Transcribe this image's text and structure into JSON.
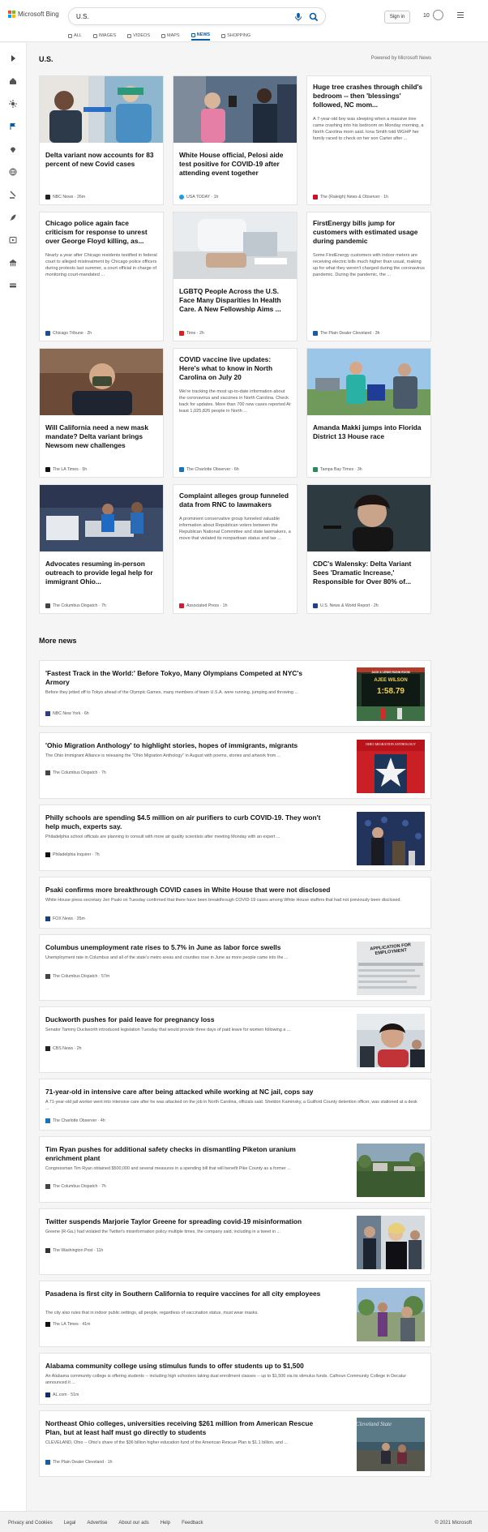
{
  "header": {
    "brand": "Microsoft Bing",
    "query": "U.S.",
    "signin": "Sign in",
    "rewards": "10"
  },
  "nav": [
    "ALL",
    "IMAGES",
    "VIDEOS",
    "MAPS",
    "NEWS",
    "SHOPPING"
  ],
  "section": {
    "title": "U.S.",
    "powered": "Powered by Microsoft News"
  },
  "cards": [
    {
      "title": "Delta variant now accounts for 83 percent of new Covid cases",
      "desc": "",
      "source": "NBC News · 26m",
      "fav": "#222"
    },
    {
      "title": "White House official, Pelosi aide test positive for COVID-19 after attending event together",
      "desc": "",
      "source": "USA TODAY · 1h",
      "fav": "#1e9be9"
    },
    {
      "title": "Huge tree crashes through child's bedroom -- then 'blessings' followed, NC mom...",
      "desc": "A 7-year-old boy was sleeping when a massive tree came crashing into his bedroom on Monday morning, a North Carolina mom said. Iona Smith told WGHP her family raced to check on her son Carter after ...",
      "source": "The (Raleigh) News & Observer · 1h",
      "fav": "#c8102e"
    },
    {
      "title": "Chicago police again face criticism for response to unrest over George Floyd killing, as...",
      "desc": "Nearly a year after Chicago residents testified in federal court to alleged mistreatment by Chicago police officers during protests last summer, a court official in charge of monitoring court-mandated ...",
      "source": "Chicago Tribune · 2h",
      "fav": "#1f4e8c"
    },
    {
      "title": "LGBTQ People Across the U.S. Face Many Disparities In Health Care. A New Fellowship Aims ...",
      "desc": "",
      "source": "Time · 2h",
      "fav": "#e01e1e"
    },
    {
      "title": "FirstEnergy bills jump for customers with estimated usage during pandemic",
      "desc": "Some FirstEnergy customers with indoor meters are receiving electric bills much higher than usual, making up for what they weren't charged during the coronavirus pandemic. During the pandemic, the ...",
      "source": "The Plain Dealer Cleveland · 3h",
      "fav": "#1a5aa8"
    },
    {
      "title": "Will California need a new mask mandate? Delta variant brings Newsom new challenges",
      "desc": "",
      "source": "The LA Times · 5h",
      "fav": "#111"
    },
    {
      "title": "COVID vaccine live updates: Here's what to know in North Carolina on July 20",
      "desc": "We're tracking the most up-to-date information about the coronavirus and vaccines in North Carolina. Check back for updates. More than 700 new cases reported At least 1,025,826 people in North ...",
      "source": "The Charlotte Observer · 6h",
      "fav": "#1772c2"
    },
    {
      "title": "Amanda Makki jumps into Florida District 13 House race",
      "desc": "",
      "source": "Tampa Bay Times · 3h",
      "fav": "#2a8a5e"
    },
    {
      "title": "Advocates resuming in-person outreach to provide legal help for immigrant Ohio...",
      "desc": "",
      "source": "The Columbus Dispatch · 7h",
      "fav": "#444"
    },
    {
      "title": "Complaint alleges group funneled data from RNC to lawmakers",
      "desc": "A prominent conservative group funneled valuable information about Republican voters between the Republican National Committee and state lawmakers, a move that violated its nonpartisan status and tax ...",
      "source": "Associated Press · 1h",
      "fav": "#d01f2f"
    },
    {
      "title": "CDC's Walensky: Delta Variant Sees 'Dramatic Increase,' Responsible for Over 80% of...",
      "desc": "",
      "source": "U.S. News & World Report · 2h",
      "fav": "#1f3f8c"
    }
  ],
  "more": {
    "title": "More news",
    "items": [
      {
        "title": "'Fastest Track in the World:' Before Tokyo, Many Olympians Competed at NYC's Armory",
        "desc": "Before they jetted off to Tokyo ahead of the Olympic Games, many members of team U.S.A. were running, jumping and throwing ...",
        "source": "NBC New York · 6h",
        "fav": "#2a3e8c",
        "sign1": "JACK & LEWIS RUDIN ROOM",
        "sign2": "AJEE WILSON",
        "sign3": "1:58.79"
      },
      {
        "title": "'Ohio Migration Anthology' to highlight stories, hopes of immigrants, migrants",
        "desc": "The Ohio Immigrant Alliance is releasing the \"Ohio Migration Anthology\" in August with poems, stories and artwork from ...",
        "source": "The Columbus Dispatch · 7h",
        "fav": "#444",
        "sign1": "OHIO MIGRATION ANTHOLOGY"
      },
      {
        "title": "Philly schools are spending $4.5 million on air purifiers to curb COVID-19. They won't help much, experts say.",
        "desc": "Philadelphia school officials are planning to consult with more air quality scientists after meeting Monday with an expert ...",
        "source": "Philadelphia Inquirer · 7h",
        "fav": "#111"
      },
      {
        "title": "Psaki confirms more breakthrough COVID cases in White House that were not disclosed",
        "desc": "White House press secretary Jen Psaki on Tuesday confirmed that there have been breakthrough COVID-19 cases among White House staffers that had not previously been disclosed.",
        "source": "FOX News · 35m",
        "fav": "#1c3f7e"
      },
      {
        "title": "Columbus unemployment rate rises to 5.7% in June as labor force swells",
        "desc": "Unemployment rate in Columbus and all of the state's metro areas and counties rose in June as more people came into the ...",
        "source": "The Columbus Dispatch · 57m",
        "fav": "#444",
        "sign1": "APPLICATION FOR EMPLOYMENT"
      },
      {
        "title": "Duckworth pushes for paid leave for pregnancy loss",
        "desc": "Senator Tammy Duckworth introduced legislation Tuesday that would provide three days of paid leave for women following a ...",
        "source": "CBS News · 2h",
        "fav": "#222"
      },
      {
        "title": "71-year-old in intensive care after being attacked while working at NC jail, cops say",
        "desc": "A 71-year-old jail worker went into intensive care after he was attacked on the job in North Carolina, officials said. Sheldon Kaminsky, a Guilford County detention officer, was stationed at a desk ...",
        "source": "The Charlotte Observer · 4h",
        "fav": "#1772c2"
      },
      {
        "title": "Tim Ryan pushes for additional safety checks in dismantling Piketon uranium enrichment plant",
        "desc": "Congressman Tim Ryan obtained $500,000 and several measures in a spending bill that will benefit Pike County as a former ...",
        "source": "The Columbus Dispatch · 7h",
        "fav": "#444"
      },
      {
        "title": "Twitter suspends Marjorie Taylor Greene for spreading covid-19 misinformation",
        "desc": "Greene (R-Ga.) had violated the Twitter's misinformation policy multiple times, the company said, including in a tweet in ...",
        "source": "The Washington Post · 11h",
        "fav": "#333"
      },
      {
        "title": "Pasadena is first city in Southern California to require vaccines for all city employees",
        "desc": "The city also rules that in indoor public settings, all people, regardless of vaccination status, must wear masks.",
        "source": "The LA Times · 41m",
        "fav": "#111"
      },
      {
        "title": "Alabama community college using stimulus funds to offer students up to $1,500",
        "desc": "An Alabama community college is offering students -- including high schoolers taking dual enrollment classes -- up to $1,500 via its stimulus funds. Calhoun Community College in Decatur announced it ...",
        "source": "AL.com · 51m",
        "fav": "#0f2f6b"
      },
      {
        "title": "Northeast Ohio colleges, universities receiving $261 million from American Rescue Plan, but at least half must go directly to students",
        "desc": "CLEVELAND, Ohio -- Ohio's share of the $36 billion higher education fund of the American Rescue Plan is $1.1 billion, and ...",
        "source": "The Plain Dealer Cleveland · 1h",
        "fav": "#1a5aa8",
        "sign1": "Cleveland State"
      }
    ]
  },
  "footer": {
    "links": [
      "Privacy and Cookies",
      "Legal",
      "Advertise",
      "About our ads",
      "Help",
      "Feedback"
    ],
    "copy": "© 2021 Microsoft"
  },
  "colors": {
    "accent": "#0b5aa6",
    "page_bg": "#f5f5f5"
  }
}
